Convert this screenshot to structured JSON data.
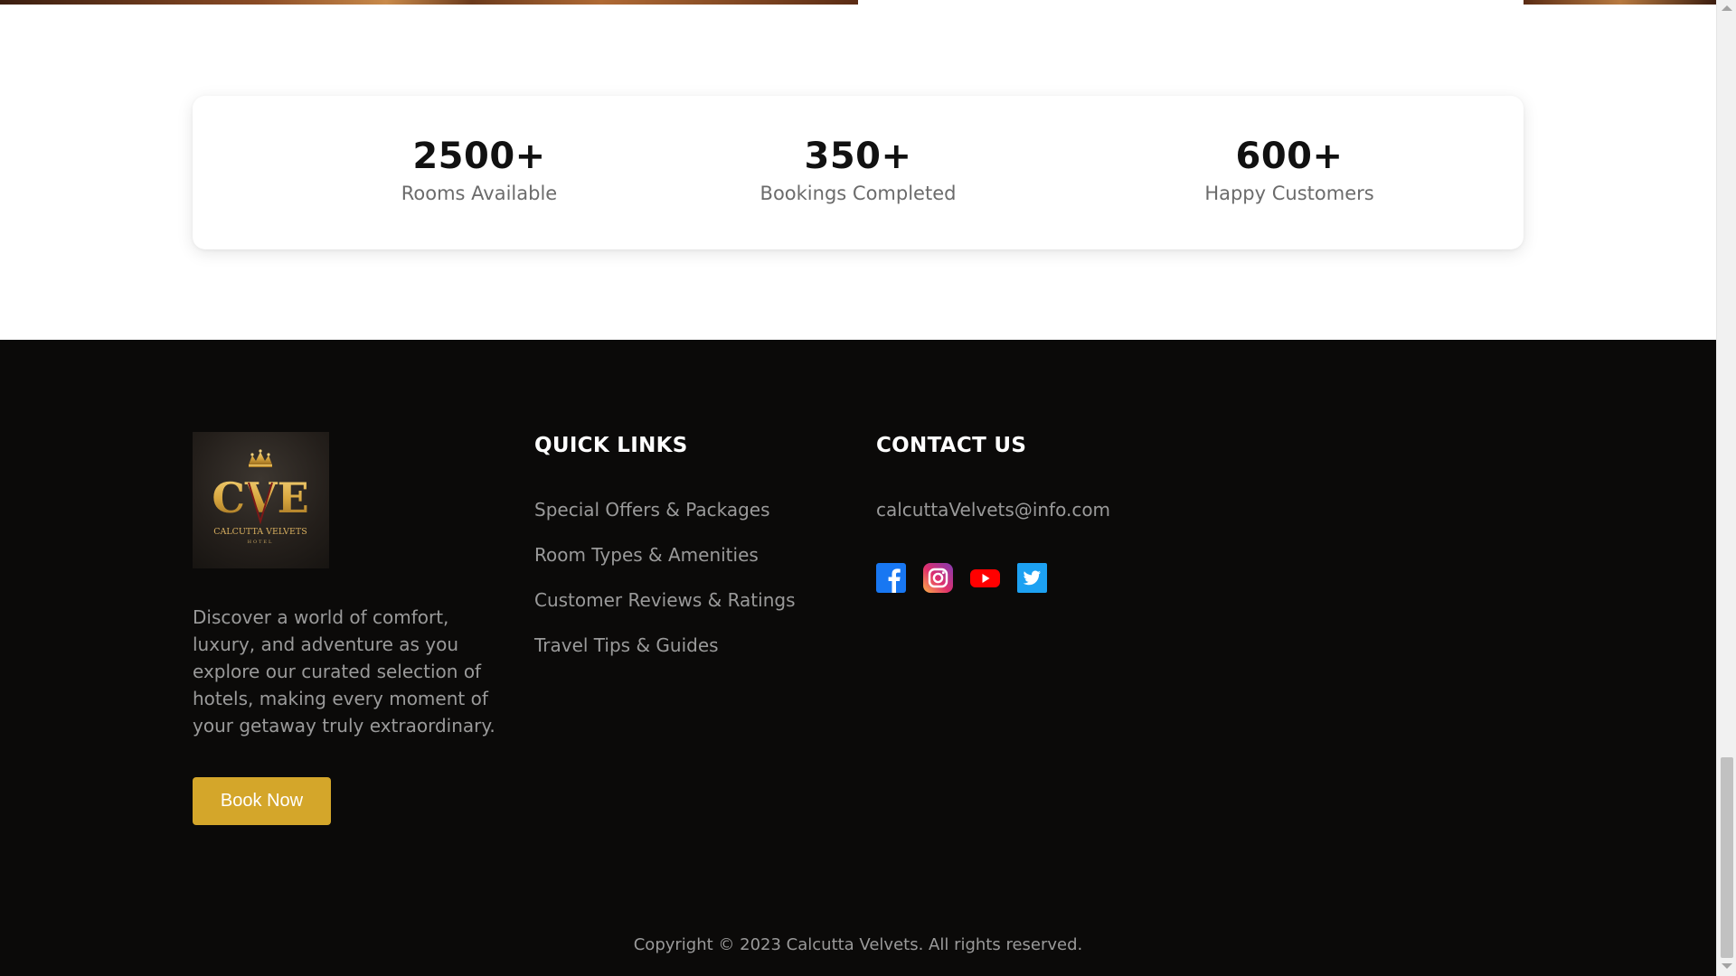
{
  "stats": [
    {
      "value": "2500+",
      "label": "Rooms Available"
    },
    {
      "value": "350+",
      "label": "Bookings Completed"
    },
    {
      "value": "600+",
      "label": "Happy Customers"
    }
  ],
  "footer": {
    "logo": {
      "monogram": "CVE",
      "brand": "CALCUTTA VELVETS",
      "sub": "HOTEL"
    },
    "about": "Discover a world of comfort, luxury, and adventure as you explore our curated selection of hotels, making every moment of your getaway truly extraordinary.",
    "book_now_label": "Book Now",
    "quick_links": {
      "title": "QUICK LINKS",
      "items": [
        {
          "label": "Special Offers & Packages"
        },
        {
          "label": "Room Types & Amenities"
        },
        {
          "label": "Customer Reviews & Ratings"
        },
        {
          "label": "Travel Tips & Guides"
        }
      ]
    },
    "contact": {
      "title": "CONTACT US",
      "email": "calcuttaVelvets@info.com",
      "socials": [
        {
          "icon": "facebook-icon",
          "color": "#1877f2"
        },
        {
          "icon": "instagram-icon",
          "color": "#e1306c"
        },
        {
          "icon": "youtube-icon",
          "color": "#ff0000"
        },
        {
          "icon": "twitter-icon",
          "color": "#1da1f2"
        }
      ]
    },
    "copyright": "Copyright © 2023 Calcutta Velvets. All rights reserved."
  },
  "colors": {
    "accent": "#d4a62a",
    "footer_bg": "#0b0a09",
    "muted_text": "#9a9a9a"
  }
}
